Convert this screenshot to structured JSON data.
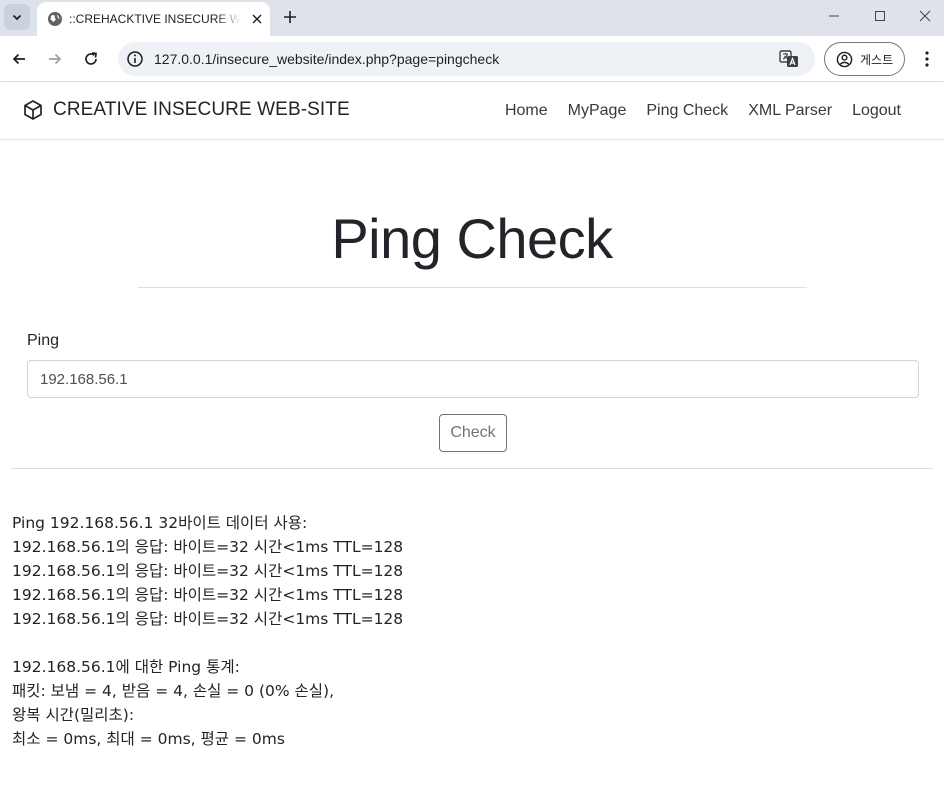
{
  "browser": {
    "tab_title": "::CREHACKTIVE INSECURE WEB",
    "url": "127.0.0.1/insecure_website/index.php?page=pingcheck",
    "profile_label": "게스트"
  },
  "navbar": {
    "brand": "CREATIVE INSECURE WEB-SITE",
    "links": [
      "Home",
      "MyPage",
      "Ping Check",
      "XML Parser",
      "Logout"
    ]
  },
  "main": {
    "title": "Ping Check",
    "field_label": "Ping",
    "input_value": "192.168.56.1",
    "button_label": "Check"
  },
  "output": {
    "lines": [
      "Ping 192.168.56.1 32바이트 데이터 사용:",
      "192.168.56.1의 응답: 바이트=32 시간<1ms TTL=128",
      "192.168.56.1의 응답: 바이트=32 시간<1ms TTL=128",
      "192.168.56.1의 응답: 바이트=32 시간<1ms TTL=128",
      "192.168.56.1의 응답: 바이트=32 시간<1ms TTL=128",
      "",
      "192.168.56.1에 대한 Ping 통계:",
      "패킷: 보냄 = 4, 받음 = 4, 손실 = 0 (0% 손실),",
      "왕복 시간(밀리초):",
      "최소 = 0ms, 최대 = 0ms, 평균 = 0ms"
    ]
  },
  "icons": {
    "tab_menu": "chevron-down-icon",
    "favicon": "globe-icon",
    "tab_close": "close-icon",
    "new_tab": "plus-icon",
    "back": "arrow-left-icon",
    "forward": "arrow-right-icon",
    "reload": "reload-icon",
    "site_info": "info-icon",
    "translate": "translate-icon",
    "profile": "person-circle-icon",
    "menu": "more-vert-icon",
    "brand": "cube-icon"
  }
}
